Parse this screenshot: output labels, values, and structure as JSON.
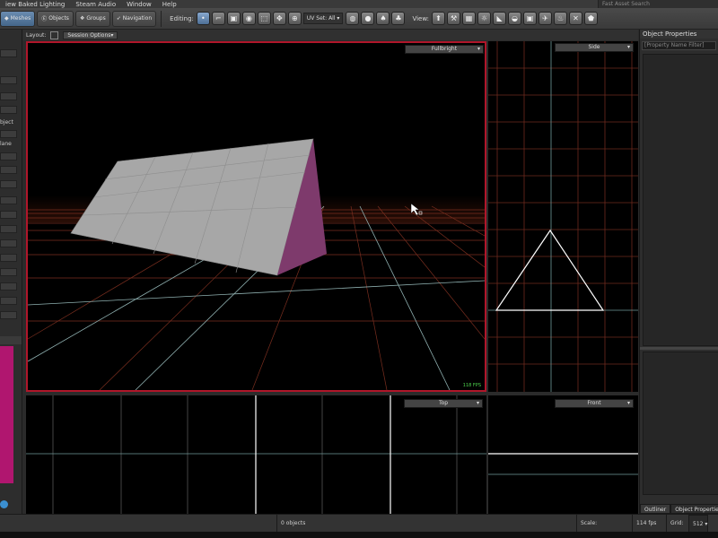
{
  "menubar": {
    "items": [
      "iew Baked Lighting",
      "Steam Audio",
      "Window",
      "Help"
    ],
    "asset_search_placeholder": "Fast Asset Search"
  },
  "toolbar": {
    "modes": [
      {
        "label": "Meshes",
        "icon": "mesh-icon",
        "active": true
      },
      {
        "label": "Objects",
        "icon": "objects-icon",
        "active": false
      },
      {
        "label": "Groups",
        "icon": "groups-icon",
        "active": false
      },
      {
        "label": "Navigation",
        "icon": "navigation-icon",
        "active": false
      }
    ],
    "editing_label": "Editing:",
    "uvset_label": "UV Set: All",
    "view_label": "View:"
  },
  "layoutbar": {
    "layout_label": "Layout:",
    "session_options": "Session Options"
  },
  "left_panel": {
    "labels": [
      "bject",
      "lane"
    ]
  },
  "viewports": {
    "perspective": {
      "mode": "Fullbright",
      "fps": "118 FPS"
    },
    "side": {
      "mode": "Side"
    },
    "top": {
      "mode": "Top"
    },
    "front": {
      "mode": "Front"
    }
  },
  "right_panel": {
    "title": "Object Properties",
    "filter_placeholder": "[Property Name Filter]",
    "tabs": [
      "Outliner",
      "Object Properties"
    ]
  },
  "statusbar": {
    "objects": "0 objects",
    "scale_label": "Scale:",
    "fps": "114 fps",
    "grid_label": "Grid:",
    "grid_value": "512"
  },
  "colors": {
    "selected_border": "#b0162a",
    "grid_main": "#8a3a2a",
    "grid_cyan": "#7fa6a6",
    "mesh_gray": "#a7a7a7",
    "mesh_magenta": "#8a3a73",
    "swatch_magenta": "#b0166f"
  }
}
